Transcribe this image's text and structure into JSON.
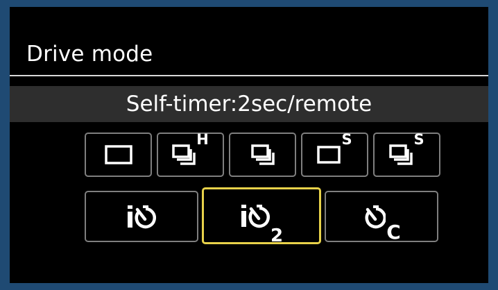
{
  "menu": {
    "title": "Drive mode",
    "selected_mode_label": "Self-timer:2sec/remote"
  },
  "drive_modes": {
    "row1": [
      {
        "name": "single-shooting",
        "icon": "single-frame-icon",
        "suffix": ""
      },
      {
        "name": "high-speed-continuous",
        "icon": "continuous-shooting-icon",
        "suffix": "H"
      },
      {
        "name": "low-speed-continuous",
        "icon": "continuous-shooting-icon",
        "suffix": ""
      },
      {
        "name": "silent-single",
        "icon": "single-frame-icon",
        "suffix": "S"
      },
      {
        "name": "silent-continuous",
        "icon": "continuous-shooting-icon",
        "suffix": "S"
      }
    ],
    "row2": [
      {
        "name": "self-timer-10sec",
        "icon": "self-timer-remote-icon",
        "suffix": ""
      },
      {
        "name": "self-timer-2sec",
        "icon": "self-timer-remote-icon",
        "suffix": "2",
        "selected": true
      },
      {
        "name": "self-timer-continuous",
        "icon": "self-timer-icon",
        "suffix": "C"
      }
    ]
  },
  "colors": {
    "background_frame": "#1f4a73",
    "screen": "#000000",
    "selected_bar": "#2e2e2e",
    "option_border": "#7f7f7f",
    "selection_highlight": "#e8d24a",
    "text": "#ffffff"
  }
}
